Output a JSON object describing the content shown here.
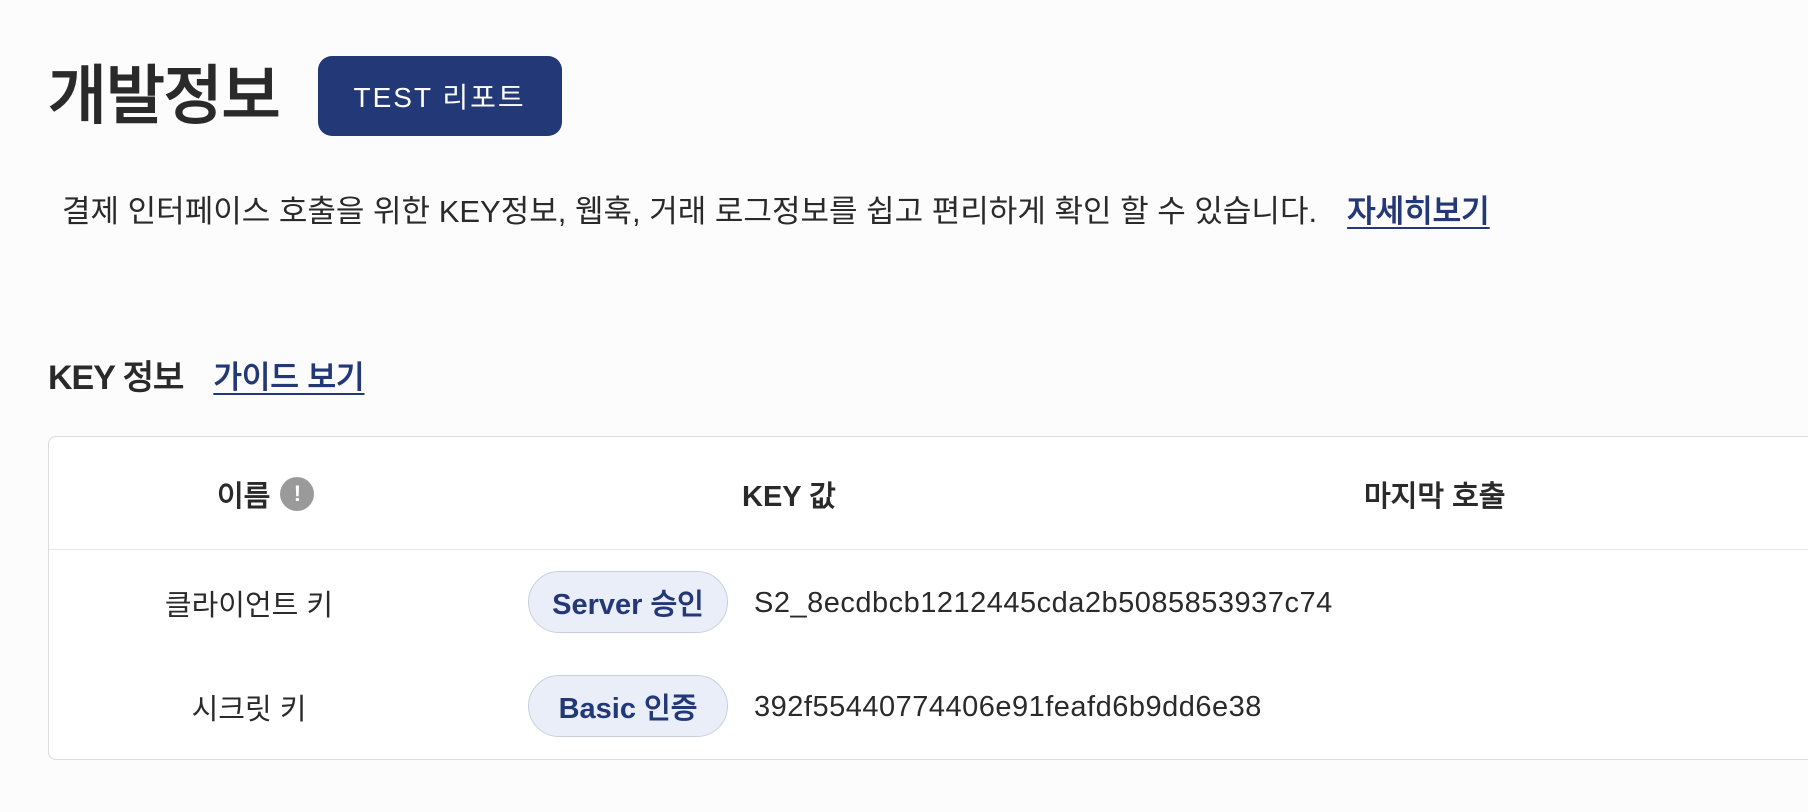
{
  "header": {
    "title": "개발정보",
    "test_report_label": "TEST 리포트"
  },
  "description": {
    "text": "결제 인터페이스 호출을 위한 KEY정보, 웹훅, 거래 로그정보를 쉽고 편리하게 확인 할 수 있습니다.",
    "link_label": "자세히보기"
  },
  "key_section": {
    "title": "KEY 정보",
    "guide_link_label": "가이드 보기",
    "columns": {
      "name": "이름",
      "key_value": "KEY 값",
      "last_call": "마지막 호출"
    },
    "info_icon_glyph": "!",
    "rows": [
      {
        "name": "클라이언트 키",
        "badge": "Server 승인",
        "key": "S2_8ecdbcb1212445cda2b5085853937c74",
        "last_call": ""
      },
      {
        "name": "시크릿 키",
        "badge": "Basic 인증",
        "key": "392f55440774406e91feafd6b9dd6e38",
        "last_call": ""
      }
    ]
  },
  "colors": {
    "primary": "#233876",
    "badge_bg": "#e9eef8",
    "background": "#fcfcfc",
    "info_icon": "#9a9a9a"
  }
}
